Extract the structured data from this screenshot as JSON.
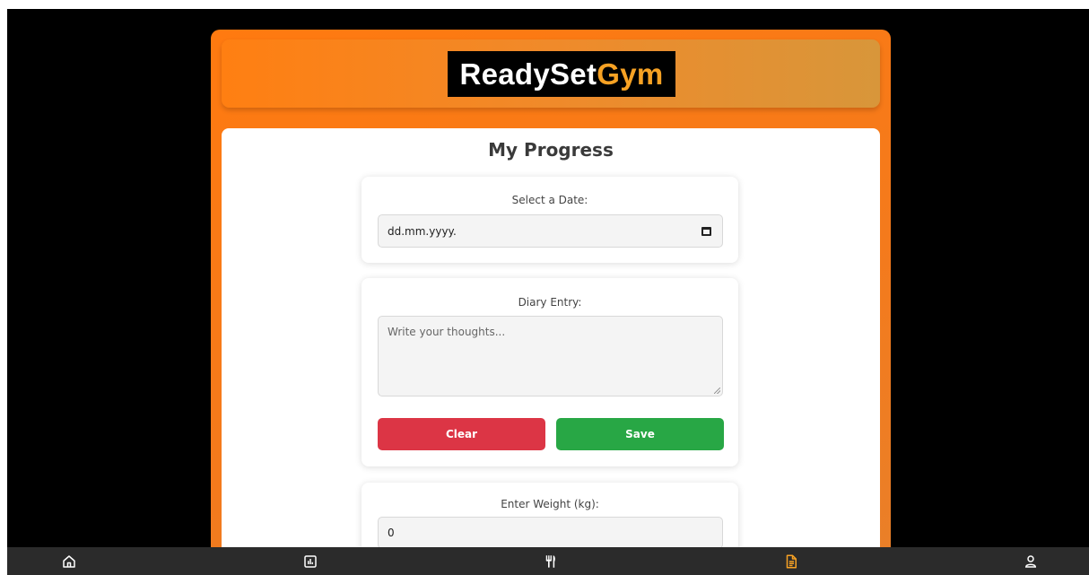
{
  "brand": {
    "part1": "ReadySet",
    "part2": "Gym"
  },
  "page": {
    "title": "My Progress"
  },
  "date_section": {
    "label": "Select a Date:",
    "value": "dd.mm.yyyy."
  },
  "diary_section": {
    "label": "Diary Entry:",
    "placeholder": "Write your thoughts...",
    "clear_label": "Clear",
    "save_label": "Save"
  },
  "weight_section": {
    "label": "Enter Weight (kg):",
    "value": "0"
  },
  "nav": {
    "items": [
      {
        "icon": "home-icon",
        "active": false
      },
      {
        "icon": "chart-icon",
        "active": false
      },
      {
        "icon": "fork-knife-icon",
        "active": false
      },
      {
        "icon": "document-icon",
        "active": true
      },
      {
        "icon": "user-icon",
        "active": false
      }
    ],
    "active_color": "#f7a224",
    "inactive_color": "#ffffff"
  },
  "colors": {
    "accent": "#ff7a10",
    "clear": "#dc3545",
    "save": "#28a745"
  }
}
